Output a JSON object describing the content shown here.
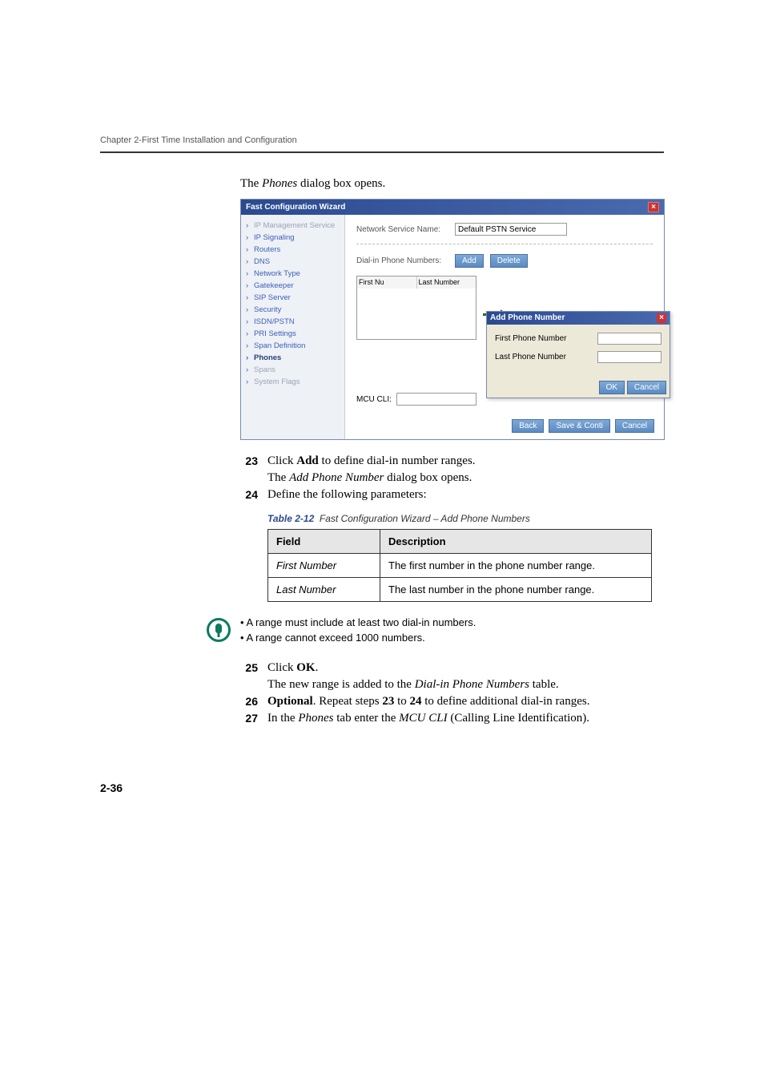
{
  "header": {
    "chapter": "Chapter 2-First Time Installation and Configuration"
  },
  "intro": {
    "pre": "The ",
    "em": "Phones",
    "post": " dialog box opens."
  },
  "wizard": {
    "title": "Fast Configuration Wizard",
    "sidebar": [
      "IP Management Service",
      "IP Signaling",
      "Routers",
      "DNS",
      "Network Type",
      "Gatekeeper",
      "SIP Server",
      "Security",
      "ISDN/PSTN",
      "PRI Settings",
      "Span Definition",
      "Phones",
      "Spans",
      "System Flags"
    ],
    "activeIndex": 11,
    "mutedIndexes": [
      0,
      12,
      13
    ],
    "nsn_label": "Network Service Name:",
    "nsn_value": "Default PSTN Service",
    "dpn_label": "Dial-in Phone Numbers:",
    "add_btn": "Add",
    "delete_btn": "Delete",
    "col1": "First Nu",
    "col2": "Last Number",
    "mcu_label": "MCU CLI:",
    "inner": {
      "title": "Add Phone Number",
      "first": "First Phone Number",
      "last": "Last Phone Number",
      "ok": "OK",
      "cancel": "Cancel"
    },
    "footer": {
      "back": "Back",
      "save": "Save & Conti",
      "cancel": "Cancel"
    }
  },
  "steps": {
    "s23": {
      "num": "23",
      "t1a": "Click ",
      "t1b": "Add",
      "t1c": " to define dial-in number ranges.",
      "t2a": "The ",
      "t2b": "Add Phone Number",
      "t2c": " dialog box opens."
    },
    "s24": {
      "num": "24",
      "t": "Define the following parameters:"
    },
    "s25": {
      "num": "25",
      "t1a": "Click ",
      "t1b": "OK",
      "t1c": ".",
      "t2a": "The new range is added to the ",
      "t2b": "Dial-in Phone Numbers",
      "t2c": " table."
    },
    "s26": {
      "num": "26",
      "t1": "Optional",
      "t2": ". Repeat steps ",
      "t3": "23",
      "t4": " to ",
      "t5": "24",
      "t6": " to define additional dial-in ranges."
    },
    "s27": {
      "num": "27",
      "t1": "In the ",
      "t2": "Phones",
      "t3": " tab enter the ",
      "t4": "MCU CLI",
      "t5": " (Calling Line Identification)."
    }
  },
  "table": {
    "caption_label": "Table 2-12",
    "caption_text": "Fast Configuration Wizard – Add Phone Numbers",
    "h1": "Field",
    "h2": "Description",
    "r1f": "First Number",
    "r1d": "The first number in the phone number range.",
    "r2f": "Last Number",
    "r2d": "The last number in the phone number range."
  },
  "note": {
    "b1": "A range must include at least two dial-in numbers.",
    "b2": "A range cannot exceed 1000 numbers."
  },
  "page": "2-36"
}
